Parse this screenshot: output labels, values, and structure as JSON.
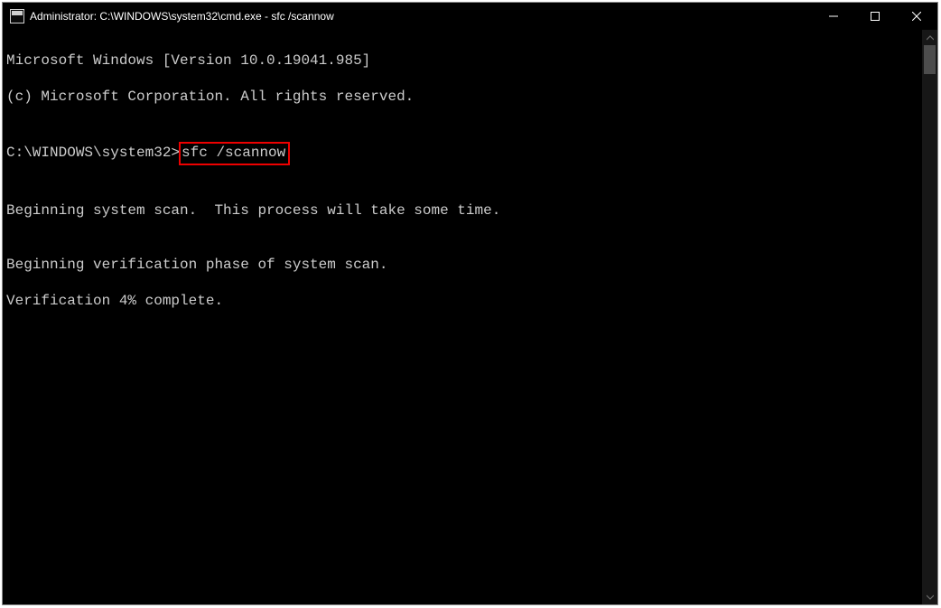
{
  "window": {
    "title": "Administrator: C:\\WINDOWS\\system32\\cmd.exe - sfc  /scannow"
  },
  "terminal": {
    "line_version": "Microsoft Windows [Version 10.0.19041.985]",
    "line_copyright": "(c) Microsoft Corporation. All rights reserved.",
    "blank": "",
    "prompt_prefix": "C:\\WINDOWS\\system32>",
    "prompt_command": "sfc /scannow",
    "line_begin_scan": "Beginning system scan.  This process will take some time.",
    "line_begin_verify": "Beginning verification phase of system scan.",
    "line_verify_progress": "Verification 4% complete."
  },
  "highlight_color": "#ed0000"
}
